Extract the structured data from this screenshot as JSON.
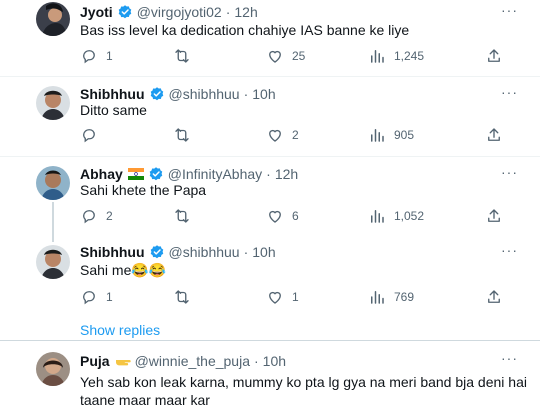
{
  "tweets": [
    {
      "name": "Jyoti",
      "handle": "@virgojyoti02",
      "time": "12h",
      "text": "Bas iss level ka dedication chahiye IAS banne ke liye",
      "reply_count": "1",
      "retweet_count": "",
      "like_count": "25",
      "view_count": "1,245"
    },
    {
      "name": "Shibhhuu",
      "handle": "@shibhhuu",
      "time": "10h",
      "text": "Ditto same",
      "reply_count": "",
      "retweet_count": "",
      "like_count": "2",
      "view_count": "905"
    },
    {
      "name": "Abhay",
      "handle": "@InfinityAbhay",
      "time": "12h",
      "text": "Sahi khete the Papa",
      "reply_count": "2",
      "retweet_count": "",
      "like_count": "6",
      "view_count": "1,052"
    },
    {
      "name": "Shibhhuu",
      "handle": "@shibhhuu",
      "time": "10h",
      "text": "Sahi me😂😂",
      "reply_count": "1",
      "retweet_count": "",
      "like_count": "1",
      "view_count": "769"
    },
    {
      "name": "Puja",
      "handle": "@winnie_the_puja",
      "time": "10h",
      "text_line1": "Yeh sab kon leak karna, mummy ko pta lg gya na meri band bja deni hai",
      "text_line2": "taane maar maar kar"
    }
  ],
  "show_replies": "Show replies",
  "more_glyph": "···",
  "dot": "·",
  "colors": {
    "accent": "#1d9bf0",
    "secondary_text": "#536471",
    "primary_text": "#0f1419"
  },
  "icons": [
    "reply-icon",
    "retweet-icon",
    "like-icon",
    "views-icon",
    "share-icon",
    "verified-badge-icon",
    "india-flag-icon",
    "pointing-hand-icon",
    "more-icon"
  ]
}
